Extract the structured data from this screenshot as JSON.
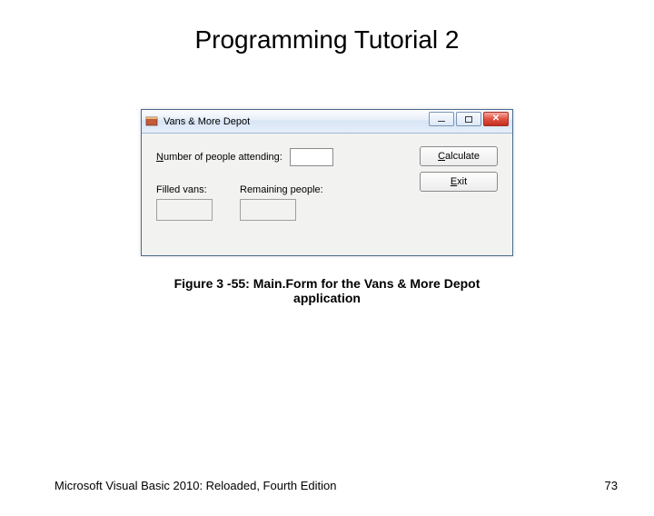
{
  "slide": {
    "title": "Programming Tutorial 2",
    "caption": "Figure 3 -55: Main.Form for the Vans & More Depot application",
    "footer_text": "Microsoft Visual Basic 2010: Reloaded, Fourth Edition",
    "page_number": "73"
  },
  "window": {
    "title": "Vans & More Depot",
    "labels": {
      "attending_prefix": "N",
      "attending_rest": "umber of people attending:",
      "filled": "Filled vans:",
      "remaining": "Remaining people:"
    },
    "buttons": {
      "calculate_prefix": "C",
      "calculate_rest": "alculate",
      "exit_prefix": "E",
      "exit_rest": "xit"
    },
    "values": {
      "attending": "",
      "filled": "",
      "remaining": ""
    }
  }
}
